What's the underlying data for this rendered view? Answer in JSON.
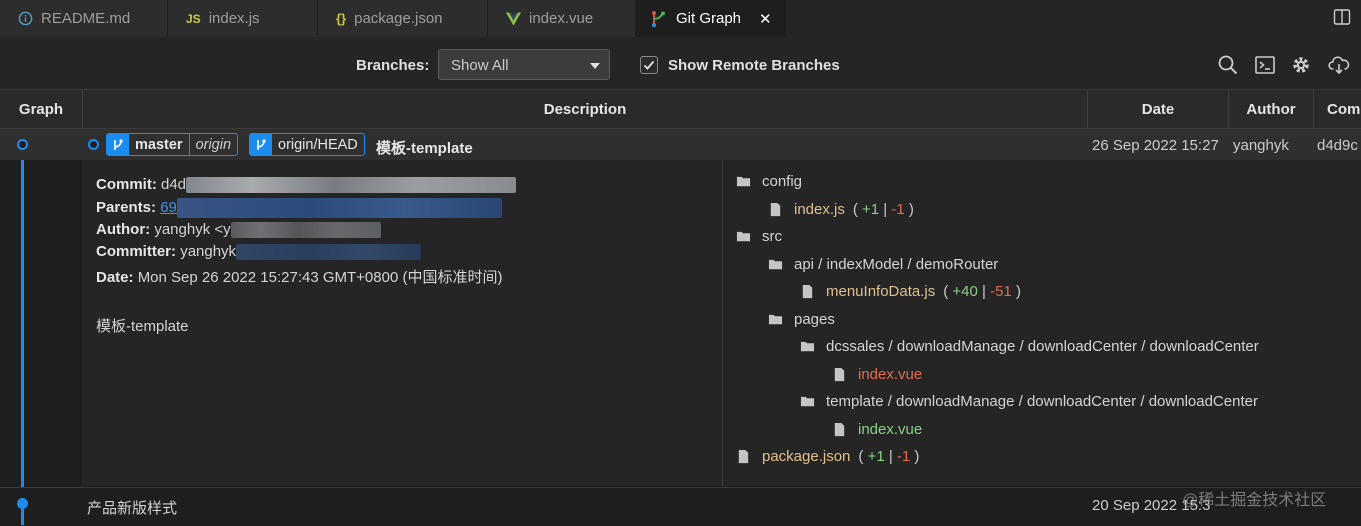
{
  "tabs": [
    {
      "label": "README.md",
      "icon": "info-icon",
      "color": "#519aba"
    },
    {
      "label": "index.js",
      "icon": "js-icon",
      "color": "#cbcb41"
    },
    {
      "label": "package.json",
      "icon": "json-braces-icon",
      "color": "#cbcb41"
    },
    {
      "label": "index.vue",
      "icon": "vue-icon",
      "color": "#8dc149"
    },
    {
      "label": "Git Graph",
      "icon": "git-graph-icon",
      "color": "#ffffff",
      "close": "✕"
    }
  ],
  "toolbar": {
    "branches_label": "Branches:",
    "branches_value": "Show All",
    "remote_label": "Show Remote Branches",
    "remote_checked": true,
    "icons": [
      "search-icon",
      "terminal-icon",
      "gear-icon",
      "cloud-download-icon"
    ]
  },
  "columns": {
    "graph": "Graph",
    "description": "Description",
    "date": "Date",
    "author": "Author",
    "commit": "Com"
  },
  "commit": {
    "branch": "master",
    "branch_remote": "origin",
    "head_ref": "origin/HEAD",
    "message": "模板-template",
    "date": "26 Sep 2022 15:27",
    "author": "yanghyk",
    "hash": "d4d9c"
  },
  "details": {
    "commit_label": "Commit:",
    "commit_value": "d4d",
    "parents_label": "Parents:",
    "parents_value": "69",
    "author_label": "Author:",
    "author_value": "yanghyk <y",
    "committer_label": "Committer:",
    "committer_value": "yanghyk",
    "date_label": "Date:",
    "date_value": "Mon Sep 26 2022 15:27:43 GMT+0800 (中国标准时间)",
    "body": "模板-template"
  },
  "files": {
    "config": "config",
    "index_js": {
      "name": "index.js",
      "plus": "+1",
      "minus": "-1"
    },
    "src": "src",
    "api_path": "api / indexModel / demoRouter",
    "menuinfo": {
      "name": "menuInfoData.js",
      "plus": "+40",
      "minus": "-51"
    },
    "pages": "pages",
    "dcssales_path": "dcssales / downloadManage / downloadCenter / downloadCenter",
    "dcssales_file": "index.vue",
    "template_path": "template / downloadManage / downloadCenter / downloadCenter",
    "template_file": "index.vue",
    "package_json": {
      "name": "package.json",
      "plus": "+1",
      "minus": "-1"
    }
  },
  "row2": {
    "message": "产品新版样式",
    "date": "20 Sep 2022 15:3"
  },
  "watermark": "@稀土掘金技术社区",
  "colors": {
    "accent": "#1d8cf0",
    "modified": "#e2c08d",
    "deleted": "#e06c50",
    "added": "#89d185"
  }
}
